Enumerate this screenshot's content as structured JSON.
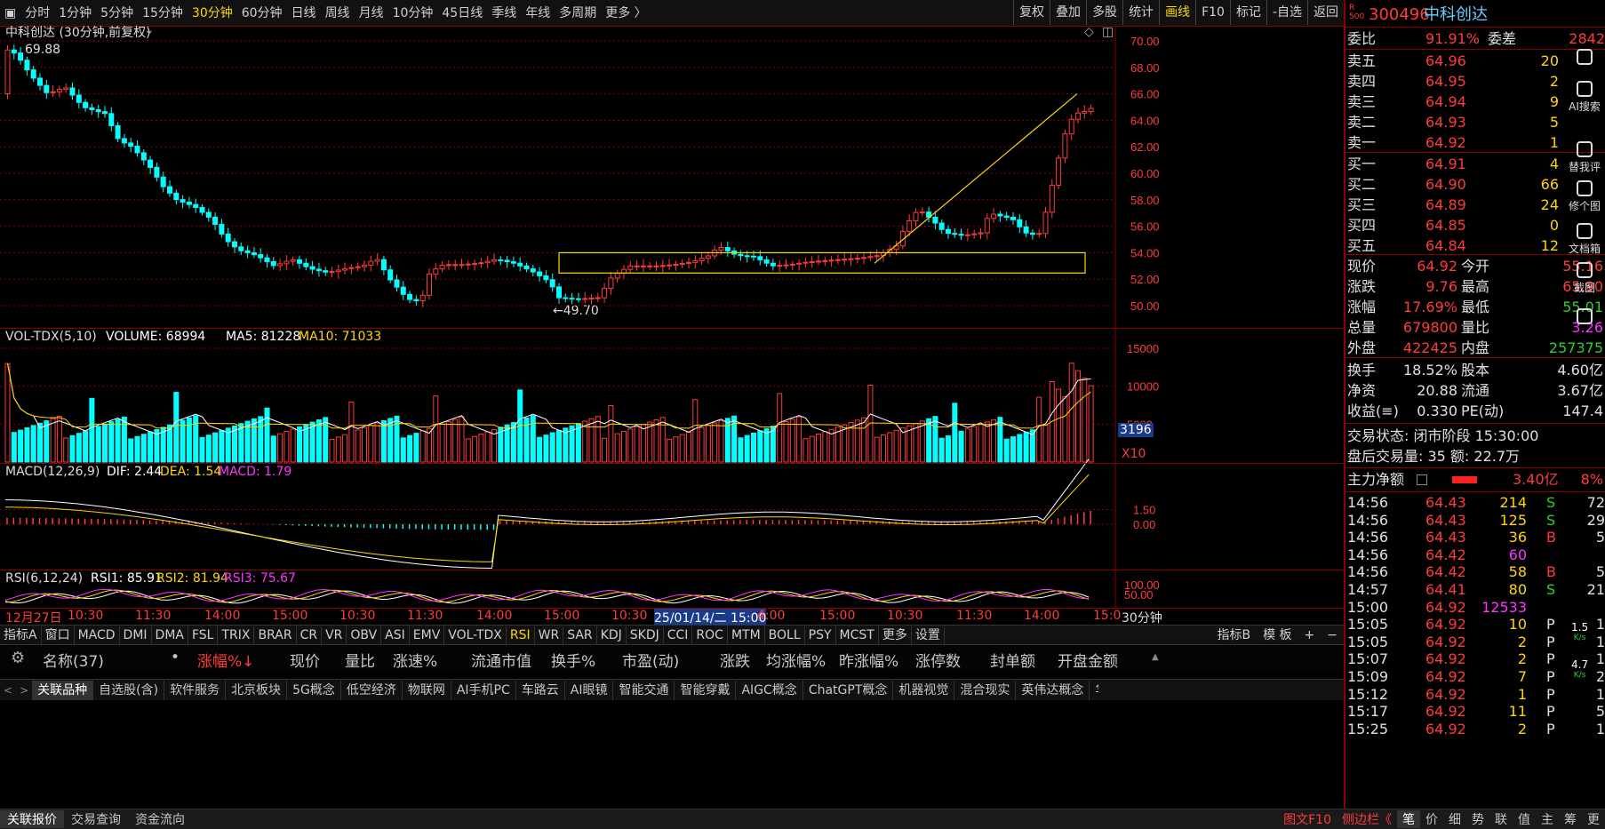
{
  "toolbar": {
    "periods": [
      "分时",
      "1分钟",
      "5分钟",
      "15分钟",
      "30分钟",
      "60分钟",
      "日线",
      "周线",
      "月线",
      "10分钟",
      "45日线",
      "季线",
      "年线",
      "多周期",
      "更多 〉"
    ],
    "active_period": "30分钟",
    "right_buttons": [
      "复权",
      "叠加",
      "多股",
      "统计",
      "画线",
      "F10",
      "标记",
      "-自选",
      "返回"
    ],
    "highlight_right": "画线"
  },
  "main_chart": {
    "title": "中科创达 (30分钟,前复权)",
    "high_label": "69.88",
    "low_label": "←49.70",
    "y_ticks": [
      "70.00",
      "68.00",
      "66.00",
      "64.00",
      "62.00",
      "60.00",
      "58.00",
      "56.00",
      "54.00",
      "52.00",
      "50.00"
    ]
  },
  "volume": {
    "title": "VOL-TDX(5,10)",
    "volume_label": "VOLUME: 68994",
    "ma5_label": "MA5: 81228",
    "ma10_label": "MA10: 71033",
    "y_ticks": [
      "15000",
      "10000",
      "5000"
    ],
    "marker": "3196",
    "unit": "X10"
  },
  "macd": {
    "title": "MACD(12,26,9)",
    "dif": "DIF: 2.44",
    "dea": "DEA: 1.54",
    "macd": "MACD: 1.79",
    "y_ticks": [
      "1.50",
      "0.00"
    ]
  },
  "rsi": {
    "title": "RSI(6,12,24)",
    "rsi1": "RSI1: 85.91",
    "rsi2": "RSI2: 81.94",
    "rsi3": "RSI3: 75.67",
    "y_ticks": [
      "100.00",
      "50.00"
    ]
  },
  "time_axis": {
    "labels": [
      "12月27日",
      "10:30",
      "11:30",
      "14:00",
      "15:00",
      "10:30",
      "11:30",
      "14:00",
      "15:00",
      "10:30",
      "25/01/14/二 15:00",
      "4:00",
      "15:00",
      "10:30",
      "11:30",
      "14:00",
      "15:0"
    ],
    "period": "30分钟"
  },
  "indicator_bar": {
    "items": [
      "指标A",
      "窗口",
      "MACD",
      "DMI",
      "DMA",
      "FSL",
      "TRIX",
      "BRAR",
      "CR",
      "VR",
      "OBV",
      "ASI",
      "EMV",
      "VOL-TDX",
      "RSI",
      "WR",
      "SAR",
      "KDJ",
      "SKDJ",
      "CCI",
      "ROC",
      "MTM",
      "BOLL",
      "PSY",
      "MCST",
      "更多",
      "设置"
    ],
    "active": "RSI",
    "right": [
      "指标B",
      "模 板",
      "+",
      "−"
    ]
  },
  "columns": {
    "items": [
      "名称(37)",
      "•",
      "涨幅%↓",
      "现价",
      "量比",
      "涨速%",
      "流通市值",
      "换手%",
      "市盈(动)",
      "涨跌",
      "均涨幅%",
      "昨涨幅%",
      "涨停数",
      "封单额",
      "开盘金额"
    ]
  },
  "sector_tabs": [
    "关联品种",
    "自选股(含)",
    "软件服务",
    "北京板块",
    "5G概念",
    "低空经济",
    "物联网",
    "AI手机PC",
    "车路云",
    "AI眼镜",
    "智能交通",
    "智能穿戴",
    "AIGC概念",
    "ChatGPT概念",
    "机器视觉",
    "混合现实",
    "英伟达概念",
    "华为鸿"
  ],
  "status_bar": {
    "items": [
      "关联报价",
      "交易查询",
      "资金流向"
    ],
    "right": [
      "图文F10",
      "侧边栏《",
      "笔",
      "价",
      "细",
      "势",
      "联",
      "值",
      "主",
      "筹",
      "更"
    ]
  },
  "quote": {
    "code": "300496",
    "name": "中科创达",
    "wb_label": "委比",
    "wb_value": "91.91%",
    "wc_label": "委差",
    "wc_value": "2842",
    "asks": [
      {
        "label": "卖五",
        "price": "64.96",
        "vol": "20"
      },
      {
        "label": "卖四",
        "price": "64.95",
        "vol": "2"
      },
      {
        "label": "卖三",
        "price": "64.94",
        "vol": "9"
      },
      {
        "label": "卖二",
        "price": "64.93",
        "vol": "5"
      },
      {
        "label": "卖一",
        "price": "64.92",
        "vol": "1"
      }
    ],
    "bids": [
      {
        "label": "买一",
        "price": "64.91",
        "vol": "4"
      },
      {
        "label": "买二",
        "price": "64.90",
        "vol": "66"
      },
      {
        "label": "买三",
        "price": "64.89",
        "vol": "24"
      },
      {
        "label": "买四",
        "price": "64.85",
        "vol": "0"
      },
      {
        "label": "买五",
        "price": "64.84",
        "vol": "12"
      }
    ],
    "stats": [
      [
        "现价",
        "64.92",
        "今开",
        "55.16"
      ],
      [
        "涨跌",
        "9.76",
        "最高",
        "65.90"
      ],
      [
        "涨幅",
        "17.69%",
        "最低",
        "55.01"
      ],
      [
        "总量",
        "679800",
        "量比",
        "3.26"
      ],
      [
        "外盘",
        "422425",
        "内盘",
        "257375"
      ]
    ],
    "stats2": [
      [
        "换手",
        "18.52%",
        "股本",
        "4.60亿"
      ],
      [
        "净资",
        "20.88",
        "流通",
        "3.67亿"
      ],
      [
        "收益(≡)",
        "0.330",
        "PE(动)",
        "147.4"
      ]
    ],
    "trade_status": "交易状态: 闭市阶段 15:30:00",
    "after_hours": "盘后交易量: 35  额: 22.7万",
    "main_net_label": "主力净额",
    "main_net_value": "3.40亿",
    "main_net_pct": "8%",
    "ticks": [
      [
        "14:56",
        "64.43",
        "214",
        "S",
        "72"
      ],
      [
        "14:56",
        "64.43",
        "125",
        "S",
        "29"
      ],
      [
        "14:56",
        "64.43",
        "36",
        "B",
        "5"
      ],
      [
        "14:56",
        "64.42",
        "60",
        "",
        ""
      ],
      [
        "14:56",
        "64.42",
        "58",
        "B",
        "5"
      ],
      [
        "14:57",
        "64.41",
        "80",
        "S",
        "21"
      ],
      [
        "15:00",
        "64.92",
        "12533",
        "",
        ""
      ],
      [
        "15:05",
        "64.92",
        "10",
        "P",
        "1"
      ],
      [
        "15:05",
        "64.92",
        "2",
        "P",
        "1"
      ],
      [
        "15:07",
        "64.92",
        "2",
        "P",
        "1"
      ],
      [
        "15:09",
        "64.92",
        "7",
        "P",
        "2"
      ],
      [
        "15:12",
        "64.92",
        "1",
        "P",
        "1"
      ],
      [
        "15:17",
        "64.92",
        "11",
        "P",
        "5"
      ],
      [
        "15:25",
        "64.92",
        "2",
        "P",
        "1"
      ]
    ]
  },
  "sidebar": [
    {
      "label": "",
      "icon": "heart-icon"
    },
    {
      "label": "AI搜索",
      "icon": "ai-search-icon"
    },
    {
      "label": "替我评",
      "icon": "review-icon"
    },
    {
      "label": "修个图",
      "icon": "image-edit-icon"
    },
    {
      "label": "文档箱",
      "icon": "document-icon"
    },
    {
      "label": "截图",
      "icon": "screenshot-icon"
    },
    {
      "label": "",
      "icon": "settings-icon"
    }
  ],
  "speed": {
    "a": "1.5",
    "a_unit": "K/s",
    "b": "4.7",
    "b_unit": "K/s"
  },
  "colors": {
    "up": "#ff3b3b",
    "down": "#00ffff",
    "ma5": "#ffffff",
    "ma10": "#ffd700",
    "grid": "#8b0000"
  }
}
